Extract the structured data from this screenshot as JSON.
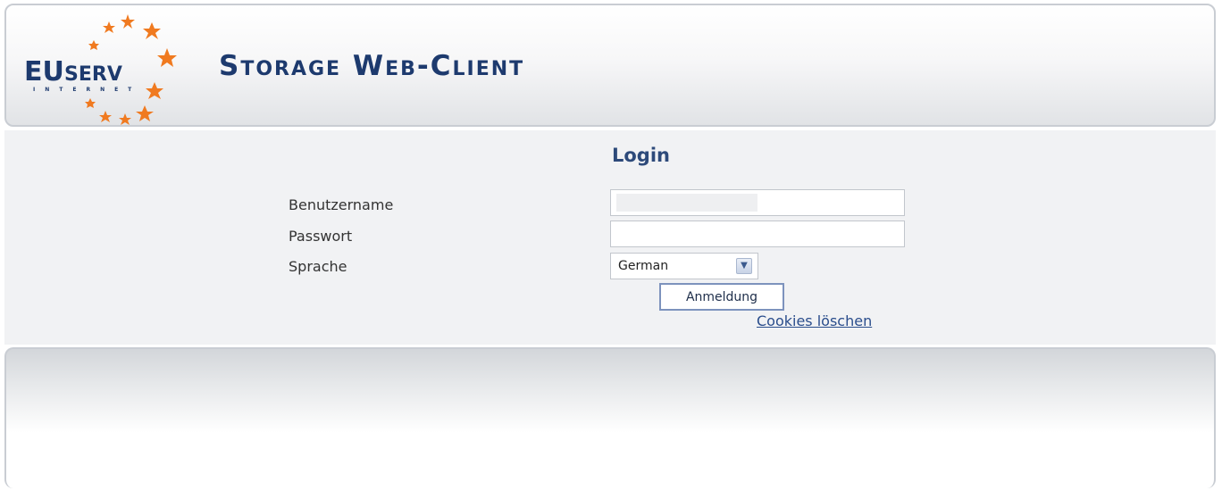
{
  "header": {
    "brand_main": "EU",
    "brand_suffix": "SERV",
    "brand_tagline": "INTERNET",
    "app_title": "Storage Web-Client",
    "star_color": "#f07a20",
    "brand_color": "#1d3a6e"
  },
  "login": {
    "title": "Login",
    "username_label": "Benutzername",
    "username_value": "",
    "password_label": "Passwort",
    "password_value": "",
    "language_label": "Sprache",
    "language_value": "German",
    "submit_label": "Anmeldung",
    "cookies_link": "Cookies löschen"
  },
  "icons": {
    "select_arrow": "chevron-down-icon"
  }
}
